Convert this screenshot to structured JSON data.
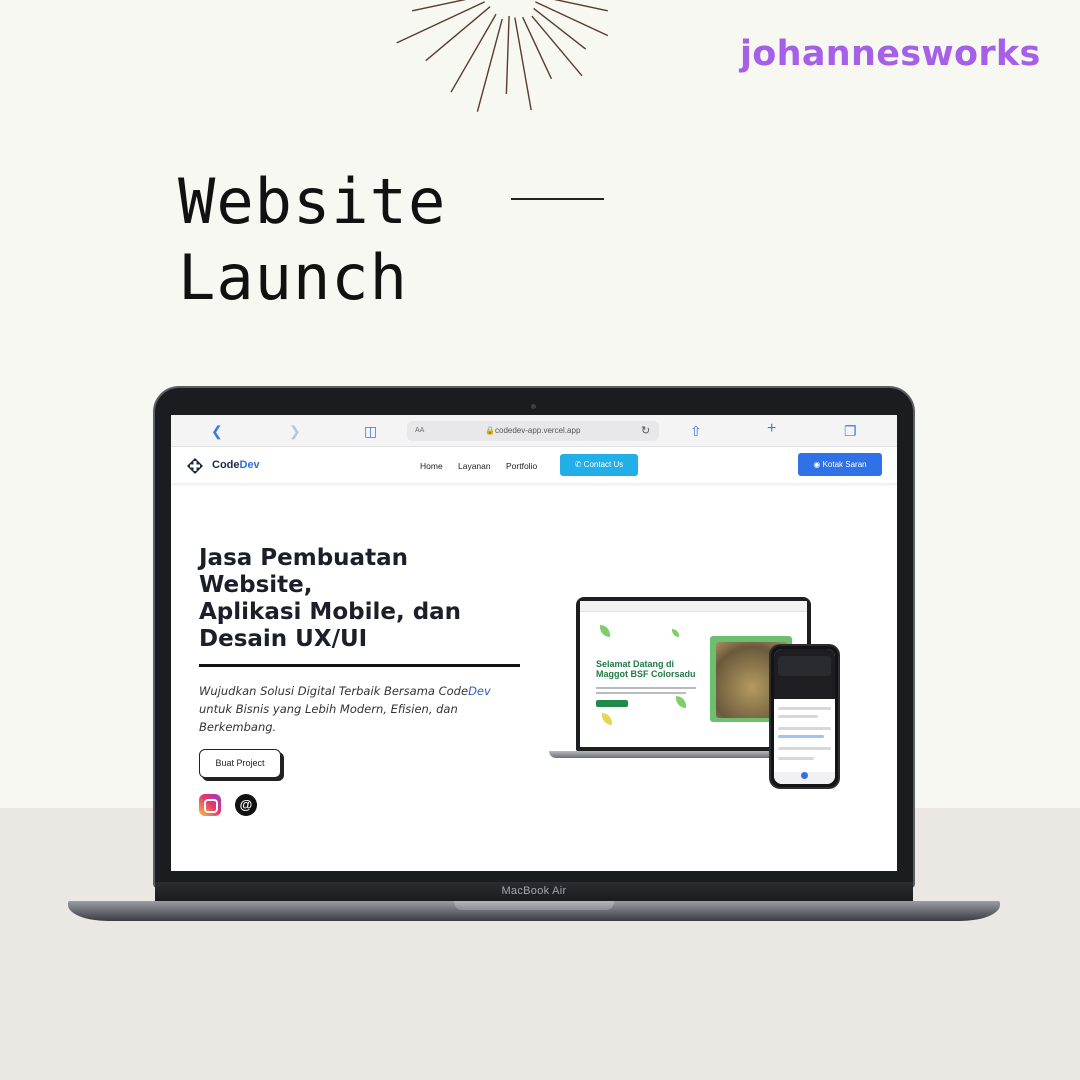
{
  "brand": "johannesworks",
  "headline": {
    "line1": "Website",
    "line2": "Launch"
  },
  "device": {
    "label": "MacBook Air"
  },
  "browser": {
    "url_prefix": "AA",
    "url": "codedev-app.vercel.app",
    "icons": [
      "back-icon",
      "forward-icon",
      "book-icon",
      "lock-icon",
      "reload-icon",
      "share-icon",
      "plus-icon",
      "tabs-icon"
    ]
  },
  "site": {
    "logo": {
      "part1": "Code",
      "part2": "Dev"
    },
    "nav": [
      "Home",
      "Layanan",
      "Portfolio"
    ],
    "contact_button": "Contact Us",
    "feedback_button": "Kotak Saran",
    "hero": {
      "title_lines": [
        "Jasa Pembuatan",
        "Website,",
        "Aplikasi Mobile, dan",
        "Desain UX/UI"
      ],
      "subtitle_part1": "Wujudkan Solusi Digital Terbaik Bersama Code",
      "subtitle_highlight": "Dev",
      "subtitle_part2": " untuk Bisnis yang Lebih Modern, Efisien, dan Berkembang.",
      "cta": "Buat Project"
    },
    "social": [
      "instagram-icon",
      "threads-icon"
    ],
    "mockup": {
      "headline_lines": [
        "Selamat Datang di",
        "Maggot BSF Colorsadu"
      ]
    }
  },
  "colors": {
    "brand_purple": "#a660e8",
    "contact_blue": "#22aee6",
    "feedback_blue": "#2f71e6",
    "floor": "#ebe8e3",
    "background": "#f8f8f3"
  }
}
